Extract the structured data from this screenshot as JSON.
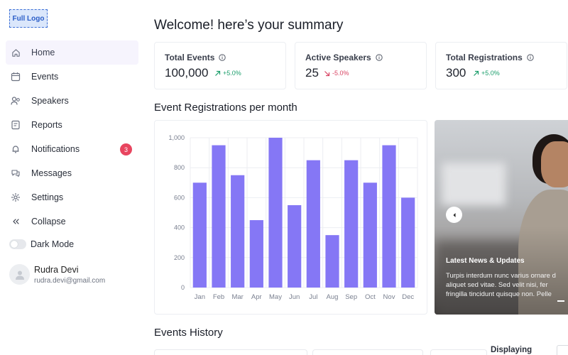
{
  "logo": "Full Logo",
  "sidebar": {
    "items": [
      {
        "label": "Home",
        "icon": "home-icon"
      },
      {
        "label": "Events",
        "icon": "calendar-icon"
      },
      {
        "label": "Speakers",
        "icon": "speakers-icon"
      },
      {
        "label": "Reports",
        "icon": "reports-icon"
      },
      {
        "label": "Notifications",
        "icon": "bell-icon",
        "badge": "3"
      },
      {
        "label": "Messages",
        "icon": "messages-icon"
      },
      {
        "label": "Settings",
        "icon": "gear-icon"
      },
      {
        "label": "Collapse",
        "icon": "collapse-icon"
      }
    ],
    "dark_mode_label": "Dark Mode",
    "user": {
      "name": "Rudra Devi",
      "email": "rudra.devi@gmail.com"
    }
  },
  "header": {
    "title": "Welcome! here’s your summary"
  },
  "stats": [
    {
      "title": "Total Events",
      "value": "100,000",
      "change": "+5.0%",
      "trend": "up"
    },
    {
      "title": "Active Speakers",
      "value": "25",
      "change": "-5.0%",
      "trend": "down"
    },
    {
      "title": "Total Registrations",
      "value": "300",
      "change": "+5.0%",
      "trend": "up"
    }
  ],
  "sections": {
    "registrations_title": "Event Registrations per month",
    "history_title": "Events History",
    "displaying_label": "Displaying"
  },
  "news": {
    "title": "Latest News & Updates",
    "lines": [
      "Turpis interdum nunc varius ornare d",
      "aliquet sed vitae. Sed velit nisi, fer",
      "fringilla tincidunt quisque non. Pelle"
    ]
  },
  "colors": {
    "accent": "#8577f5",
    "positive": "#1a9e6b",
    "negative": "#d84463",
    "badge": "#e8455f"
  },
  "chart_data": {
    "type": "bar",
    "title": "",
    "xlabel": "",
    "ylabel": "",
    "categories": [
      "Jan",
      "Feb",
      "Mar",
      "Apr",
      "May",
      "Jun",
      "Jul",
      "Aug",
      "Sep",
      "Oct",
      "Nov",
      "Dec"
    ],
    "values": [
      700,
      950,
      750,
      450,
      1000,
      550,
      850,
      350,
      850,
      700,
      950,
      600
    ],
    "ylim": [
      0,
      1000
    ],
    "yticks": [
      0,
      200,
      400,
      600,
      800,
      1000
    ],
    "ytick_labels": [
      "0",
      "200",
      "400",
      "600",
      "800",
      "1,000"
    ],
    "grid": true,
    "color": "#8577f5"
  }
}
